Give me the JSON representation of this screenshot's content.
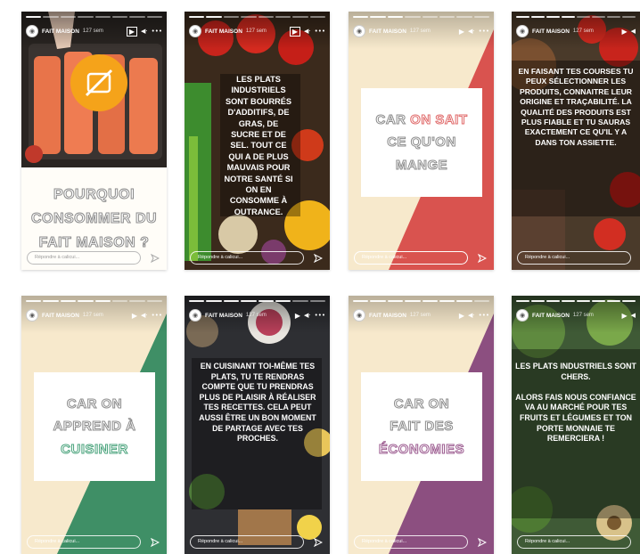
{
  "account": {
    "name": "FAIT MAISON",
    "time": "127 sem"
  },
  "reply_placeholder": "Répondre à calicui...",
  "stories": [
    {
      "id": 1,
      "title_lines": [
        "POURQUOI",
        "CONSOMMER DU",
        "FAIT MAISON ?"
      ]
    },
    {
      "id": 2,
      "text": "LES PLATS INDUSTRIELS SONT BOURRÉS D'ADDITIFS, DE GRAS, DE SUCRE ET DE SEL. TOUT CE QUI A DE PLUS MAUVAIS POUR NOTRE SANTÉ SI ON EN CONSOMME À OUTRANCE."
    },
    {
      "id": 3,
      "lines": [
        "CAR ",
        "ON SAIT",
        "CE QU'ON",
        "MANGE"
      ],
      "accent": "#e06a6a"
    },
    {
      "id": 4,
      "text": "EN FAISANT TES COURSES TU PEUX SÉLECTIONNER LES PRODUITS, CONNAITRE LEUR ORIGINE ET TRAÇABILITÉ. LA QUALITÉ DES PRODUITS EST PLUS FIABLE ET TU SAURAS EXACTEMENT CE QU'IL Y A DANS TON ASSIETTE."
    },
    {
      "id": 5,
      "lines": [
        "CAR ON",
        "APPREND À",
        "CUISINER"
      ],
      "accent": "#4aa37c"
    },
    {
      "id": 6,
      "text": "EN CUISINANT TOI-MÊME TES PLATS, TU TE RENDRAS COMPTE QUE TU PRENDRAS PLUS DE PLAISIR À RÉALISER TES RECETTES. CELA PEUT AUSSI ÊTRE UN BON MOMENT DE PARTAGE AVEC TES PROCHES."
    },
    {
      "id": 7,
      "lines": [
        "CAR ON",
        "FAIT DES",
        "ÉCONOMIES"
      ],
      "accent": "#9b5a8f"
    },
    {
      "id": 8,
      "text": "LES PLATS INDUSTRIELS SONT CHERS.\n\nALORS FAIS NOUS CONFIANCE VA AU MARCHÉ POUR TES FRUITS ET LÉGUMES ET TON PORTE MONNAIE TE REMERCIERA !"
    }
  ],
  "colors": {
    "cream": "#f7e9cc",
    "red": "#d9534f",
    "green": "#3f8f66",
    "purple": "#8c4f80",
    "orange": "#f5a31a"
  },
  "icons": [
    "play-icon",
    "volume-icon",
    "more-icon",
    "send-icon",
    "no-microwave-icon"
  ]
}
